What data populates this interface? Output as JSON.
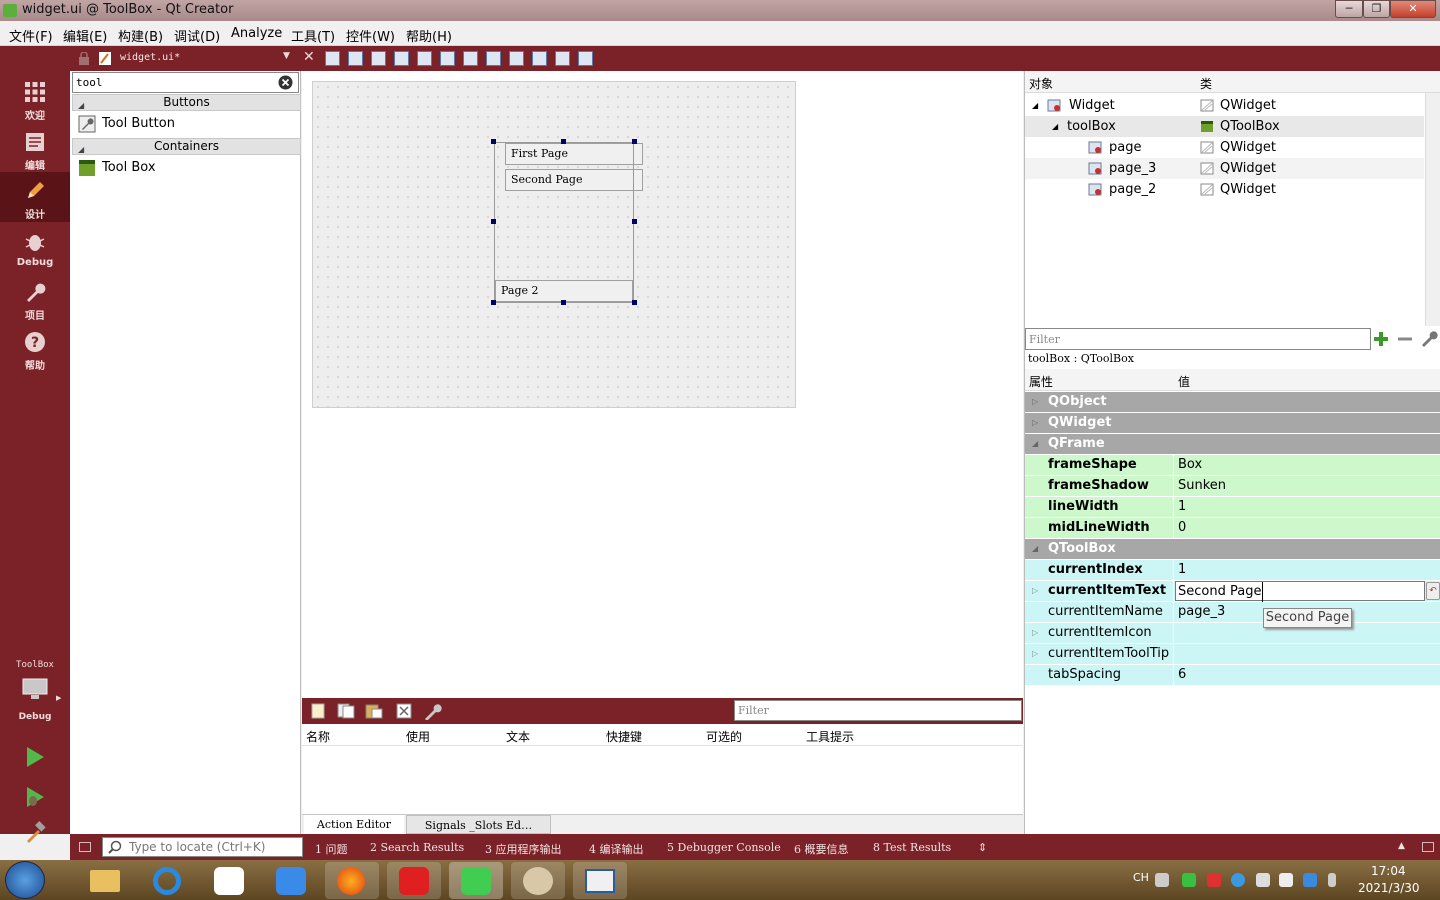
{
  "window": {
    "title": "widget.ui @ ToolBox - Qt Creator",
    "min": "─",
    "max": "❐",
    "close": "✕"
  },
  "menu": [
    "文件(F)",
    "编辑(E)",
    "构建(B)",
    "调试(D)",
    "Analyze",
    "工具(T)",
    "控件(W)",
    "帮助(H)"
  ],
  "modes": [
    {
      "label": "欢迎",
      "icon": "grid-icon"
    },
    {
      "label": "编辑",
      "icon": "document-icon"
    },
    {
      "label": "设计",
      "icon": "pencil-icon"
    },
    {
      "label": "Debug",
      "icon": "bug-icon"
    },
    {
      "label": "项目",
      "icon": "wrench-icon"
    },
    {
      "label": "帮助",
      "icon": "help-icon"
    }
  ],
  "kit": {
    "project": "ToolBox",
    "config": "Debug"
  },
  "editor_tab": {
    "file": "widget.ui*"
  },
  "widgetbox": {
    "search_value": "tool",
    "categories": [
      {
        "name": "Buttons",
        "items": [
          "Tool Button"
        ]
      },
      {
        "name": "Containers",
        "items": [
          "Tool Box"
        ]
      }
    ]
  },
  "form": {
    "pages": [
      "First Page",
      "Second Page",
      "Page 2"
    ]
  },
  "action_editor": {
    "filter_placeholder": "Filter",
    "columns": [
      "名称",
      "使用",
      "文本",
      "快捷键",
      "可选的",
      "工具提示"
    ],
    "tabs": [
      "Action Editor",
      "Signals _Slots Ed…"
    ]
  },
  "object_inspector": {
    "columns": [
      "对象",
      "类"
    ],
    "rows": [
      {
        "object": "Widget",
        "class": "QWidget"
      },
      {
        "object": "toolBox",
        "class": "QToolBox"
      },
      {
        "object": "page",
        "class": "QWidget"
      },
      {
        "object": "page_3",
        "class": "QWidget"
      },
      {
        "object": "page_2",
        "class": "QWidget"
      }
    ]
  },
  "property_editor": {
    "filter_placeholder": "Filter",
    "class_line": "toolBox : QToolBox",
    "columns": [
      "属性",
      "值"
    ],
    "rows": [
      {
        "kind": "group",
        "name": "QObject",
        "value": ""
      },
      {
        "kind": "group",
        "name": "QWidget",
        "value": ""
      },
      {
        "kind": "group",
        "name": "QFrame",
        "value": ""
      },
      {
        "kind": "green",
        "name": "frameShape",
        "value": "Box"
      },
      {
        "kind": "green",
        "name": "frameShadow",
        "value": "Sunken"
      },
      {
        "kind": "green",
        "name": "lineWidth",
        "value": "1"
      },
      {
        "kind": "green",
        "name": "midLineWidth",
        "value": "0"
      },
      {
        "kind": "group",
        "name": "QToolBox",
        "value": ""
      },
      {
        "kind": "cyan-bold",
        "name": "currentIndex",
        "value": "1"
      },
      {
        "kind": "edit",
        "name": "currentItemText",
        "value": "Second Page"
      },
      {
        "kind": "cyan",
        "name": "currentItemName",
        "value": "page_3"
      },
      {
        "kind": "cyan",
        "name": "currentItemIcon",
        "value": ""
      },
      {
        "kind": "cyan",
        "name": "currentItemToolTip",
        "value": ""
      },
      {
        "kind": "cyan",
        "name": "tabSpacing",
        "value": "6"
      }
    ],
    "tooltip": "Second Page"
  },
  "locator": {
    "placeholder": "Type to locate (Ctrl+K)"
  },
  "output_tabs": [
    "1 问题",
    "2 Search Results",
    "3 应用程序输出",
    "4 编译输出",
    "5 Debugger Console",
    "6 概要信息",
    "8 Test Results"
  ],
  "taskbar": {
    "lang": "CH",
    "time": "17:04",
    "date": "2021/3/30"
  },
  "colors": {
    "accent": "#7a2228",
    "group": "#a7a7a7",
    "green": "#ccf8cc",
    "cyan": "#ccf6f6"
  }
}
